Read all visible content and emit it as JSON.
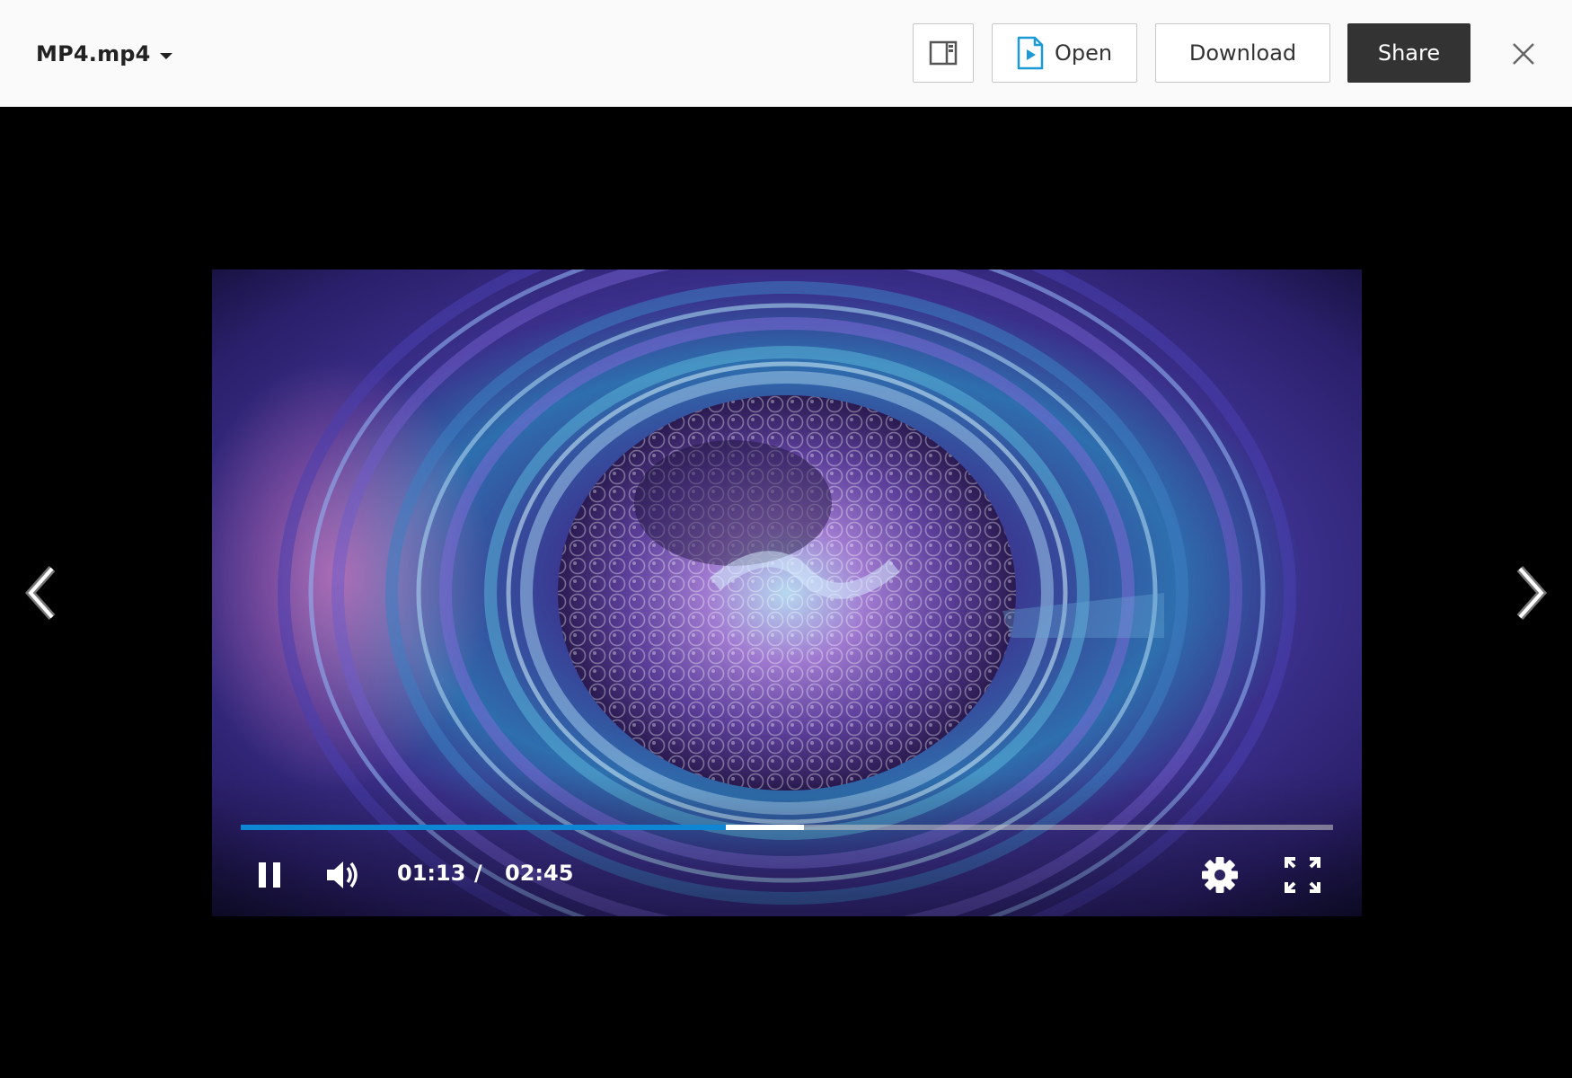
{
  "header": {
    "file_name": "MP4.mp4",
    "open_label": "Open",
    "download_label": "Download",
    "share_label": "Share"
  },
  "player": {
    "current_time": "01:13",
    "separator": "/",
    "total_time": "02:45",
    "played_fraction": 0.444,
    "buffered_fraction": 0.516,
    "state": "playing"
  },
  "icons": {
    "sidebar": "sidebar-toggle-icon",
    "open": "video-file-icon",
    "close": "close-icon",
    "prev": "chevron-left-icon",
    "next": "chevron-right-icon",
    "pause": "pause-icon",
    "volume": "volume-icon",
    "settings": "gear-icon",
    "fullscreen": "fullscreen-icon"
  },
  "colors": {
    "accent": "#0e86d4",
    "share_button": "#333333",
    "header_bg": "#fafafa",
    "viewer_bg": "#000000"
  }
}
